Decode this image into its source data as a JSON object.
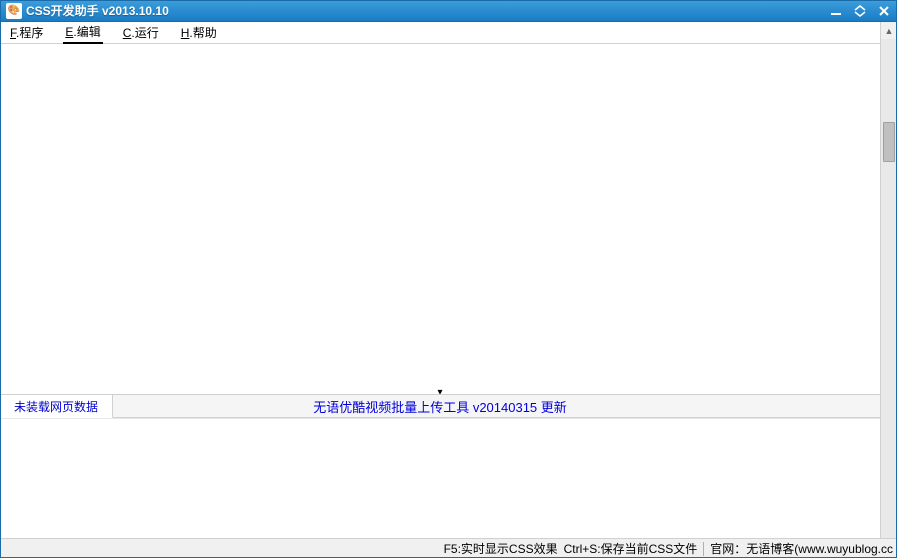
{
  "titlebar": {
    "title": "CSS开发助手 v2013.10.10",
    "app_icon": "🎨"
  },
  "menu": {
    "program": {
      "mnemonic": "F",
      "label": ".程序"
    },
    "edit": {
      "mnemonic": "E",
      "label": ".编辑"
    },
    "run": {
      "mnemonic": "C",
      "label": ".运行"
    },
    "help": {
      "mnemonic": "H",
      "label": ".帮助"
    }
  },
  "tabs": {
    "tab1": "未装载网页数据"
  },
  "update_notice": "无语优酷视频批量上传工具 v20140315 更新",
  "statusbar": {
    "hint1": "F5:实时显示CSS效果",
    "hint2": "Ctrl+S:保存当前CSS文件",
    "hint3": "官网：无语博客(www.wuyublog.cc"
  }
}
